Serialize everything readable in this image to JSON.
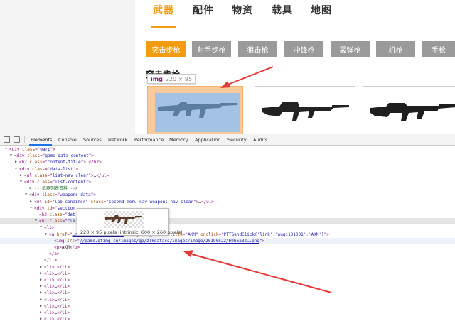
{
  "page": {
    "main_tabs": [
      "武器",
      "配件",
      "物资",
      "载具",
      "地图"
    ],
    "weapon_categories": [
      "突击步枪",
      "射手步枪",
      "狙击枪",
      "冲锋枪",
      "霰弹枪",
      "机枪",
      "手枪"
    ],
    "section_title": "突击步枪",
    "tooltip": {
      "tag": "img",
      "size": "220 × 95"
    }
  },
  "devtools": {
    "tabs": [
      "Elements",
      "Console",
      "Sources",
      "Network",
      "Performance",
      "Memory",
      "Application",
      "Security",
      "Audits"
    ],
    "lines": [
      {
        "indent": 1,
        "tri": "▼",
        "html": "<span class='tg'>&lt;div </span><span class='an'>class</span><span class='tg'>=\"</span><span class='av'>warp</span><span class='tg'>\"&gt;</span>"
      },
      {
        "indent": 2,
        "tri": "▼",
        "html": "<span class='tg'>&lt;div </span><span class='an'>class</span><span class='tg'>=\"</span><span class='av'>game-data-content</span><span class='tg'>\"&gt;</span>"
      },
      {
        "indent": 3,
        "tri": "▶",
        "html": "<span class='tg'>&lt;h2 </span><span class='an'>class</span><span class='tg'>=\"</span><span class='av'>content-title</span><span class='tg'>\"&gt;</span>…<span class='tg'>&lt;/h2&gt;</span>"
      },
      {
        "indent": 3,
        "tri": "▼",
        "html": "<span class='tg'>&lt;div </span><span class='an'>class</span><span class='tg'>=\"</span><span class='av'>data-list</span><span class='tg'>\"&gt;</span>"
      },
      {
        "indent": 4,
        "tri": "▶",
        "html": "<span class='tg'>&lt;ul </span><span class='an'>class</span><span class='tg'>=\"</span><span class='av'>list-nav clear</span><span class='tg'>\"&gt;</span>…<span class='tg'>&lt;/ul&gt;</span>"
      },
      {
        "indent": 4,
        "tri": "▼",
        "html": "<span class='tg'>&lt;div </span><span class='an'>class</span><span class='tg'>=\"</span><span class='av'>list-content</span><span class='tg'>\"&gt;</span>"
      },
      {
        "indent": 5,
        "tri": " ",
        "html": "<span class='cm'>&lt;!-- 武器列表资料 --&gt;</span>"
      },
      {
        "indent": 5,
        "tri": "▼",
        "html": "<span class='tg'>&lt;div </span><span class='an'>class</span><span class='tg'>=\"</span><span class='av'>weapons-data</span><span class='tg'>\"&gt;</span>"
      },
      {
        "indent": 6,
        "tri": "▶",
        "html": "<span class='tg'>&lt;ul </span><span class='an'>id</span><span class='tg'>=\"</span><span class='av'>lab-conainer</span><span class='tg'>\" </span><span class='an'>class</span><span class='tg'>=\"</span><span class='av'>second-menu-nav weapons-nav clear</span><span class='tg'>\"&gt;</span>…<span class='tg'>&lt;/ul&gt;</span>"
      },
      {
        "indent": 6,
        "tri": "▼",
        "html": "<span class='tg'>&lt;div </span><span class='an'>id</span><span class='tg'>=\"</span><span class='av'>section</span>"
      },
      {
        "indent": 7,
        "tri": " ",
        "html": "<span class='tg'>&lt;h3 </span><span class='an'>class</span><span class='tg'>=\"</span><span class='av'>det</span>"
      },
      {
        "indent": 7,
        "tri": "▼",
        "html": "<span class='tg'>&lt;ul </span><span class='an'>class</span><span class='tg'>=\"</span><span class='av'>cle</span>"
      },
      {
        "indent": 8,
        "tri": "▼",
        "html": "<span class='tg'>&lt;li&gt;</span>"
      },
      {
        "indent": 9,
        "tri": "▼",
        "html": "<span class='tg'>&lt;a </span><span class='an'>href</span><span class='tg'>=\"</span><span class='lk'>…ml?sort=0&amp;id=101001</span><span class='tg'>\" </span><span class='an'>target</span><span class='tg'>=\"</span><span class='av'>_blank</span><span class='tg'>\" </span><span class='an'>title</span><span class='tg'>=\"</span><span class='av'>AKM</span><span class='tg'>\" </span><span class='an'>onclick</span><span class='tg'>=\"</span><span class='av'>PTTSendClick('link','wuqi101001','AKM')</span><span class='tg'>\"&gt;</span>"
      },
      {
        "indent": 10,
        "tri": " ",
        "html": "<span class='tg'>&lt;img </span><span class='an'>src</span><span class='tg'>=\"</span><span class='lk'>//game.gtimg.cn/images/gp/zlkdatacs/images/image/20190522/b9b6a82….png</span><span class='tg'>\"&gt;</span>"
      },
      {
        "indent": 10,
        "tri": " ",
        "html": "<span class='tg'>&lt;p&gt;</span>AKM<span class='tg'>&lt;/p&gt;</span>"
      },
      {
        "indent": 9,
        "tri": " ",
        "html": "<span class='tg'>&lt;/a&gt;</span>"
      },
      {
        "indent": 8,
        "tri": " ",
        "html": "<span class='tg'>&lt;/li&gt;</span>"
      },
      {
        "indent": 8,
        "tri": "▶",
        "html": "<span class='tg'>&lt;li&gt;</span>…<span class='tg'>&lt;/li&gt;</span>"
      },
      {
        "indent": 8,
        "tri": "▶",
        "html": "<span class='tg'>&lt;li&gt;</span>…<span class='tg'>&lt;/li&gt;</span>"
      },
      {
        "indent": 8,
        "tri": "▶",
        "html": "<span class='tg'>&lt;li&gt;</span>…<span class='tg'>&lt;/li&gt;</span>"
      },
      {
        "indent": 8,
        "tri": "▶",
        "html": "<span class='tg'>&lt;li&gt;</span>…<span class='tg'>&lt;/li&gt;</span>"
      },
      {
        "indent": 8,
        "tri": "▶",
        "html": "<span class='tg'>&lt;li&gt;</span>…<span class='tg'>&lt;/li&gt;</span>"
      },
      {
        "indent": 8,
        "tri": "▶",
        "html": "<span class='tg'>&lt;li&gt;</span>…<span class='tg'>&lt;/li&gt;</span>"
      },
      {
        "indent": 8,
        "tri": "▶",
        "html": "<span class='tg'>&lt;li&gt;</span>…<span class='tg'>&lt;/li&gt;</span>"
      },
      {
        "indent": 8,
        "tri": "▶",
        "html": "<span class='tg'>&lt;li&gt;</span>…<span class='tg'>&lt;/li&gt;</span>"
      },
      {
        "indent": 8,
        "tri": "▶",
        "html": "<span class='tg'>&lt;li&gt;</span>…<span class='tg'>&lt;/li&gt;</span>"
      }
    ],
    "selected_line": 11,
    "hovered_line": 14,
    "image_preview_caption": "220 × 95 pixels (intrinsic: 600 × 260 pixels)"
  },
  "colors": {
    "accent": "#f39c12",
    "arrow": "#e53935"
  }
}
